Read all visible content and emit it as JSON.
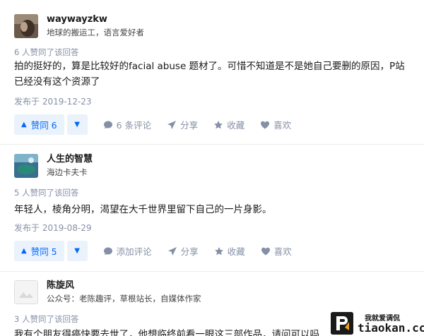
{
  "answers": [
    {
      "author_name": "waywayzkw",
      "author_bio": "地球的搬运工，语言爱好者",
      "vote_summary": "6 人赞同了该回答",
      "content": "拍的挺好的，算是比较好的facial abuse 题材了。可惜不知道是不是她自己要删的原因，P站已经没有这个资源了",
      "date": "发布于 2019-12-23",
      "upvote_label": "赞同 6",
      "comment_label": "6 条评论",
      "share_label": "分享",
      "collect_label": "收藏",
      "like_label": "喜欢"
    },
    {
      "author_name": "人生的智慧",
      "author_bio": "海边卡夫卡",
      "vote_summary": "5 人赞同了该回答",
      "content": "年轻人，棱角分明，渴望在大千世界里留下自己的一片身影。",
      "date": "发布于 2019-08-29",
      "upvote_label": "赞同 5",
      "comment_label": "添加评论",
      "share_label": "分享",
      "collect_label": "收藏",
      "like_label": "喜欢"
    },
    {
      "author_name": "陈旋风",
      "author_bio": "公众号：老陈趣评，草根站长，自媒体作家",
      "vote_summary": "3 人赞同了该回答",
      "content": "我有个朋友得癌快要去世了，他想临终前看一眼这三部作品，请问可以吗"
    }
  ],
  "watermark": {
    "line1": "我就爱调侃",
    "line2": "tiaokan.cc"
  },
  "colors": {
    "accent": "#0066ff",
    "accent_bg": "#eaf2fb",
    "muted": "#8590a6"
  }
}
